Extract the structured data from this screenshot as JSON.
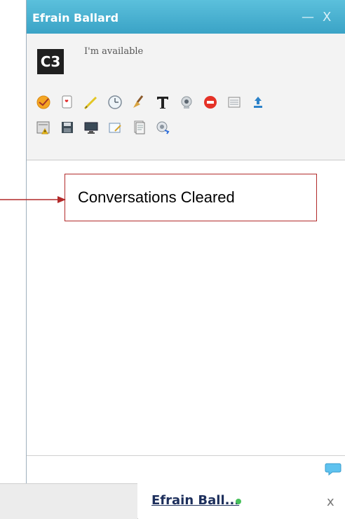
{
  "window": {
    "title": "Efrain Ballard",
    "minimize": "—",
    "close": "X"
  },
  "profile": {
    "avatar_text": "C3",
    "status": "I'm available"
  },
  "toolbar": {
    "row1": [
      "emoticon-icon",
      "card-icon",
      "pencil-icon",
      "clock-icon",
      "broom-icon",
      "text-format-icon",
      "webcam-icon",
      "block-icon",
      "list-icon",
      "upload-icon"
    ],
    "row2": [
      "calendar-icon",
      "save-icon",
      "monitor-icon",
      "notepad-icon",
      "document-icon",
      "refresh-globe-icon"
    ]
  },
  "annotation": {
    "text": "Conversations Cleared",
    "border_color": "#b22a2a"
  },
  "taskbar": {
    "tab_label": "Efrain Ball...",
    "tab_close": "x"
  },
  "colors": {
    "titlebar": "#3aa3c6",
    "online": "#47c05b"
  }
}
